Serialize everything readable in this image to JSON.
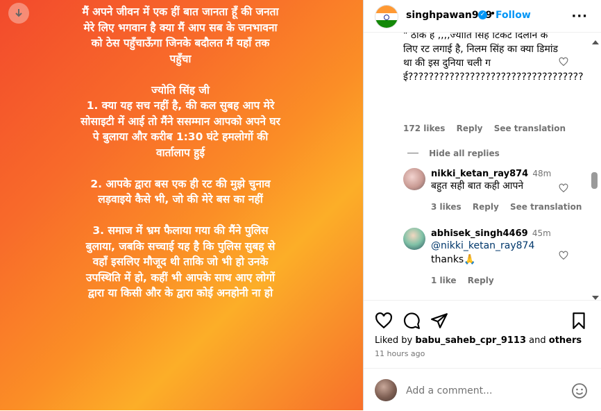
{
  "post": {
    "text": "मैं अपने जीवन में एक हीं बात जानता हूँ की जनता मेरे लिए भगवान है क्या मैं आप सब के जनभावना को ठेस पहुँचाऊँगा जिनके बदौलत मैं यहाँ तक पहुँचा\n\nज्योति सिंह जी\n1. क्या यह सच नहीं है, की कल सुबह आप मेरे सोसाइटी में आई तो मैंने ससम्मान आपको अपने घर पे बुलाया और करीब 1:30 घंटे हमलोगों की वार्तालाप हुई\n\n2. आपके द्वारा बस एक ही रट की मुझे चुनाव लड़वाइये कैसे भी, जो की मेरे बस का नहीं\n\n3. समाज में भ्रम फैलाया गया की मैंने पुलिस बुलाया, जबकि सच्चाई यह है कि पुलिस सुबह से वहाँ इसलिए मौजूद थी ताकि जो भी हो उनके उपस्थिति में हो, कहीं भी आपके साथ आए लोगों द्वारा या किसी और के द्वारा कोई अनहोनी ना हो"
  },
  "header": {
    "username": "singhpawan999",
    "follow_label": "Follow",
    "dot": "•"
  },
  "comments": [
    {
      "text": "\" ठीक है ,,,,ज्योति सिंह टिकट दिलाने के लिए रट लगाई है, निलम सिंह का क्या डिमांड था की इस दुनिया चली गई??????????????????????????????????",
      "likes": "172 likes",
      "reply": "Reply",
      "translate": "See translation"
    }
  ],
  "hide_replies": "Hide all replies",
  "replies": [
    {
      "username": "nikki_ketan_ray874",
      "time": "48m",
      "text": "बहुत सही बात कही आपने",
      "likes": "3 likes",
      "reply": "Reply",
      "translate": "See translation"
    },
    {
      "username": "abhisek_singh4469",
      "time": "45m",
      "mention": "@nikki_ketan_ray874",
      "text": "thanks🙏",
      "likes": "1 like",
      "reply": "Reply"
    }
  ],
  "likes_line": {
    "prefix": "Liked by",
    "user": "babu_saheb_cpr_9113",
    "mid": "and",
    "others": "others"
  },
  "time_ago": "11 hours ago",
  "add_comment": {
    "placeholder": "Add a comment..."
  },
  "colors": {
    "accent": "#0095f6",
    "gradient_start": "#f24a2c",
    "gradient_mid": "#fcae28"
  }
}
